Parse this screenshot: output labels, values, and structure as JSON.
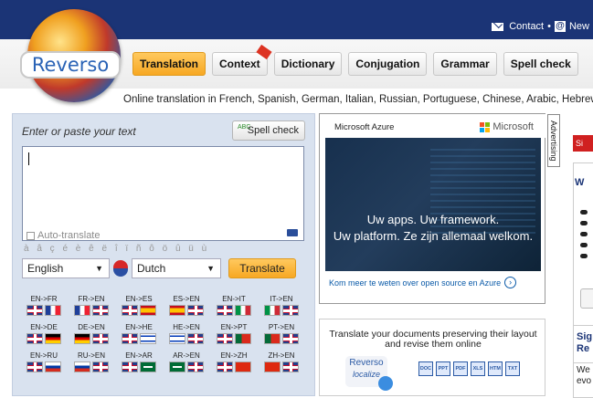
{
  "topbar": {
    "contact": "Contact",
    "bullet": "•",
    "news": "New"
  },
  "logo": {
    "text": "Reverso"
  },
  "nav": [
    {
      "label": "Translation",
      "active": true
    },
    {
      "label": "Context",
      "active": false,
      "badge": "new"
    },
    {
      "label": "Dictionary",
      "active": false
    },
    {
      "label": "Conjugation",
      "active": false
    },
    {
      "label": "Grammar",
      "active": false
    },
    {
      "label": "Spell check",
      "active": false
    }
  ],
  "tagline": "Online translation in French, Spanish, German, Italian, Russian, Portuguese, Chinese, Arabic, Hebrew, J",
  "translator": {
    "prompt": "Enter or paste your text",
    "spell_icon": "ABC",
    "spell_label": "Spell check",
    "auto_translate": "Auto-translate",
    "accents": "à â ç é è ê ë î ï ñ ô ö û ü ù",
    "source_lang": "English",
    "target_lang": "Dutch",
    "translate_label": "Translate",
    "pairs": [
      {
        "label": "EN->FR",
        "f1": "uk",
        "f2": "fr"
      },
      {
        "label": "FR->EN",
        "f1": "fr",
        "f2": "uk"
      },
      {
        "label": "EN->ES",
        "f1": "uk",
        "f2": "es"
      },
      {
        "label": "ES->EN",
        "f1": "es",
        "f2": "uk"
      },
      {
        "label": "EN->IT",
        "f1": "uk",
        "f2": "it"
      },
      {
        "label": "IT->EN",
        "f1": "it",
        "f2": "uk"
      },
      {
        "label": "EN->DE",
        "f1": "uk",
        "f2": "de"
      },
      {
        "label": "DE->EN",
        "f1": "de",
        "f2": "uk"
      },
      {
        "label": "EN->HE",
        "f1": "uk",
        "f2": "il"
      },
      {
        "label": "HE->EN",
        "f1": "il",
        "f2": "uk"
      },
      {
        "label": "EN->PT",
        "f1": "uk",
        "f2": "pt"
      },
      {
        "label": "PT->EN",
        "f1": "pt",
        "f2": "uk"
      },
      {
        "label": "EN->RU",
        "f1": "uk",
        "f2": "ru"
      },
      {
        "label": "RU->EN",
        "f1": "ru",
        "f2": "uk"
      },
      {
        "label": "EN->AR",
        "f1": "uk",
        "f2": "ar"
      },
      {
        "label": "AR->EN",
        "f1": "ar",
        "f2": "uk"
      },
      {
        "label": "EN->ZH",
        "f1": "uk",
        "f2": "cn"
      },
      {
        "label": "ZH->EN",
        "f1": "cn",
        "f2": "uk"
      }
    ]
  },
  "ad": {
    "brand": "Microsoft Azure",
    "ms_label": "Microsoft",
    "headline1": "Uw apps. Uw framework.",
    "headline2": "Uw platform. Ze zijn allemaal welkom.",
    "cta": "Kom meer te weten over open source en Azure",
    "advertising": "Advertising"
  },
  "documents": {
    "text": "Translate your documents preserving their layout and revise them online",
    "localize_brand": "Reverso",
    "localize_sub": "localize",
    "formats": [
      "DOC",
      "PPT",
      "PDF",
      "XLS",
      "HTM",
      "TXT"
    ]
  },
  "right_column": {
    "red_button": "Si",
    "box_title": "W",
    "signup_title": "Sig Re",
    "signup_text": "We evo"
  },
  "colors": {
    "header_blue": "#1b3476",
    "accent_orange": "#f7a823",
    "panel_bg": "#d9e2ef"
  }
}
